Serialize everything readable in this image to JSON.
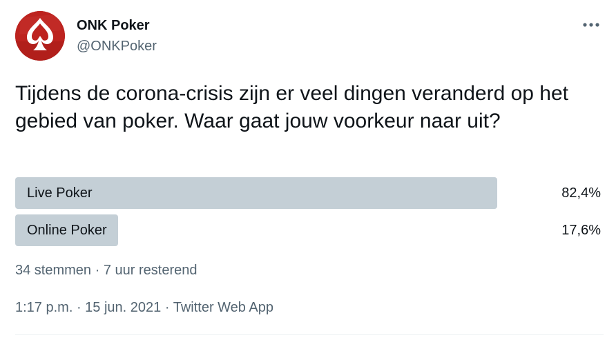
{
  "author": {
    "display_name": "ONK Poker",
    "handle": "@ONKPoker",
    "avatar_icon": "spade-logo-icon",
    "avatar_color": "#c0221f"
  },
  "more_icon": "more-dots-icon",
  "tweet": {
    "text": "Tijdens de corona-crisis zijn er veel dingen veranderd op het gebied van poker. Waar gaat jouw voorkeur naar uit?"
  },
  "poll": {
    "options": [
      {
        "label": "Live Poker",
        "percent_text": "82,4%",
        "percent": 82.4
      },
      {
        "label": "Online Poker",
        "percent_text": "17,6%",
        "percent": 17.6
      }
    ],
    "votes": "34 stemmen",
    "separator": " · ",
    "time_left": "7 uur resterend",
    "bar_color": "#c4cfd6"
  },
  "meta": {
    "time": "1:17 p.m.",
    "separator": " · ",
    "date": "15 jun. 2021",
    "source": "Twitter Web App"
  }
}
